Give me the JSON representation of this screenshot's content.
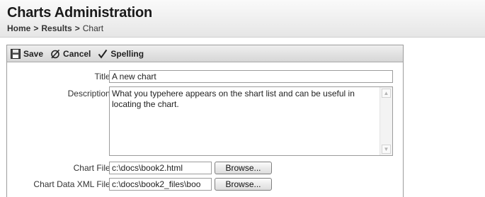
{
  "header": {
    "title": "Charts Administration",
    "breadcrumb": {
      "items": [
        "Home",
        "Results",
        "Chart"
      ],
      "separator": ">"
    }
  },
  "toolbar": {
    "save_label": "Save",
    "save_icon": "floppy-disk-icon",
    "cancel_label": "Cancel",
    "cancel_icon": "cancel-icon",
    "spelling_label": "Spelling",
    "spelling_icon": "checkmark-icon"
  },
  "form": {
    "title": {
      "label": "Title:",
      "value": "A new chart"
    },
    "description": {
      "label": "Description:",
      "value": "What you typehere appears on the shart list and can be useful in locating the chart."
    },
    "chart_file": {
      "label": "Chart File:",
      "value": "c:\\docs\\book2.html",
      "browse_label": "Browse..."
    },
    "chart_data_xml_file": {
      "label": "Chart Data XML File:",
      "value": "c:\\docs\\book2_files\\boo",
      "browse_label": "Browse..."
    }
  },
  "colors": {
    "header_bg": "#eeeeee",
    "toolbar_bg": "#e0e0e0",
    "panel_border": "#9c9c9c"
  }
}
